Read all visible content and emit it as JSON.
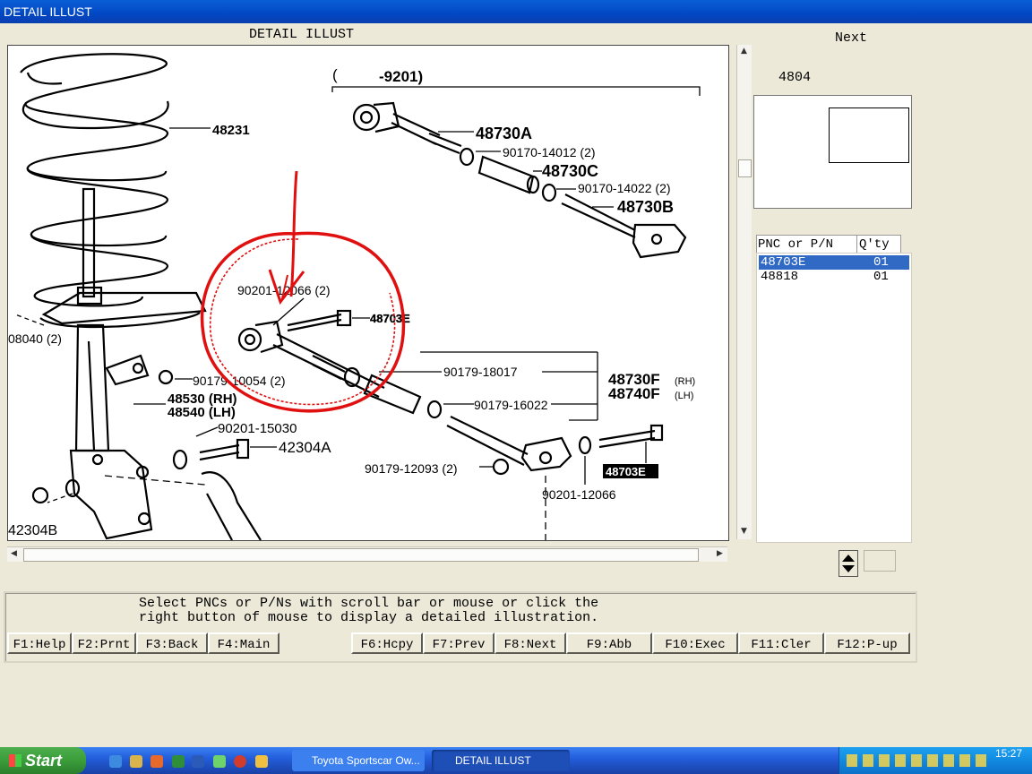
{
  "window": {
    "title": "DETAIL ILLUST"
  },
  "illustration": {
    "heading": "DETAIL ILLUST",
    "range_label_open": "(",
    "range_label_end": "-9201)",
    "labels": {
      "p48231": "48231",
      "p48730A": "48730A",
      "p90170_14012": "90170-14012 (2)",
      "p48730C": "48730C",
      "p90170_14022": "90170-14022 (2)",
      "p48730B": "48730B",
      "p90201_12066_top": "90201-12066 (2)",
      "p48703E_top": "48703E",
      "p08040": "08040 (2)",
      "p90179_10054": "90179-10054 (2)",
      "p90179_18017": "90179-18017",
      "p48730F": "48730F",
      "p48730F_side": "(RH)",
      "p48740F": "48740F",
      "p48740F_side": "(LH)",
      "p48530": "48530 (RH)",
      "p48540": "48540 (LH)",
      "p90179_16022": "90179-16022",
      "p90201_15030": "90201-15030",
      "p42304A": "42304A",
      "p90179_12093": "90179-12093 (2)",
      "p48703E_bottom": "48703E",
      "p90201_12066_bottom": "90201-12066",
      "p42304B": "42304B"
    }
  },
  "side_panel": {
    "next_label": "Next",
    "page_code": "4804",
    "list_headers": {
      "pn": "PNC or P/N",
      "qty": "Q'ty"
    },
    "list_rows": [
      {
        "pn": "48703E",
        "qty": "01",
        "selected": true
      },
      {
        "pn": "48818",
        "qty": "01",
        "selected": false
      }
    ]
  },
  "message": {
    "line1": "Select PNCs or P/Ns with scroll bar or mouse or click the",
    "line2": "right button of mouse to display a detailed illustration."
  },
  "function_keys": [
    "F1:Help",
    "F2:Prnt",
    "F3:Back",
    "F4:Main",
    "F6:Hcpy",
    "F7:Prev",
    "F8:Next",
    "F9:Abb",
    "F10:Exec",
    "F11:Cler",
    "F12:P-up"
  ],
  "taskbar": {
    "start_label": "Start",
    "tasks": [
      "Toyota Sportscar Ow...",
      "DETAIL ILLUST"
    ],
    "clock": "15:27"
  },
  "colors": {
    "selection": "#316ac5",
    "annotation": "#e01010",
    "titlebar": "#0247c4"
  }
}
